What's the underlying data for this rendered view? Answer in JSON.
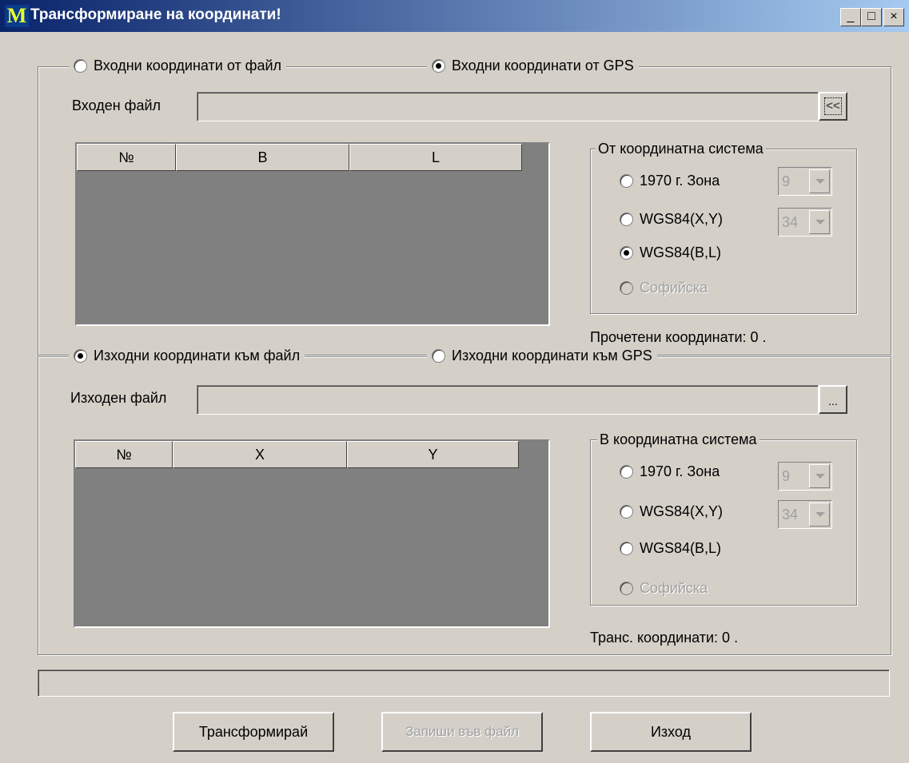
{
  "window": {
    "title": "Трансформиране на координати!",
    "logo": "M",
    "buttons": {
      "minimize": "_",
      "maximize": "□",
      "close": "×"
    }
  },
  "input": {
    "source_file_label": "Входни координати от файл",
    "source_gps_label": "Входни координати от GPS",
    "selected_source": "gps",
    "file_label": "Входен файл",
    "file_value": "",
    "browse_label": "<<",
    "table": {
      "columns": [
        "№",
        "B",
        "L"
      ],
      "rows": []
    },
    "system": {
      "title": "От координатна система",
      "options": [
        "1970 г. Зона",
        "WGS84(X,Y)",
        "WGS84(B,L)",
        "Софийска"
      ],
      "selected": 2,
      "zone_value": "9",
      "utm_zone_value": "34"
    },
    "count_text": "Прочетени координати: 0 ."
  },
  "output": {
    "dest_file_label": "Изходни координати към файл",
    "dest_gps_label": "Изходни координати към GPS",
    "selected_dest": "file",
    "file_label": "Изходен файл",
    "file_value": "",
    "browse_label": "...",
    "table": {
      "columns": [
        "№",
        "X",
        "Y"
      ],
      "rows": []
    },
    "system": {
      "title": "В координатна система",
      "options": [
        "1970 г.  Зона",
        "WGS84(X,Y)",
        "WGS84(B,L)",
        "Софийска"
      ],
      "selected": -1,
      "zone_value": "9",
      "utm_zone_value": "34"
    },
    "count_text": "Транс. координати: 0 ."
  },
  "progress": 0,
  "actions": {
    "transform": "Трансформирай",
    "save": "Запиши във файл",
    "exit": "Изход"
  }
}
